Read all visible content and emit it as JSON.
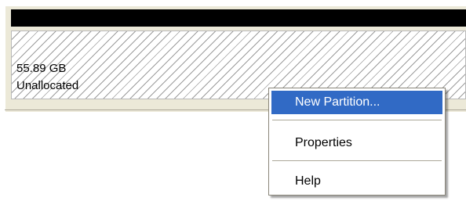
{
  "disk_panel": {
    "volume": {
      "size": "55.89 GB",
      "status": "Unallocated"
    }
  },
  "context_menu": {
    "items": [
      {
        "label": "New Partition...",
        "selected": true
      },
      {
        "label": "Properties",
        "selected": false
      },
      {
        "label": "Help",
        "selected": false
      }
    ]
  },
  "colors": {
    "header_bar": "#000000",
    "selection": "#316ac5",
    "panel_bg": "#ece9d8"
  }
}
